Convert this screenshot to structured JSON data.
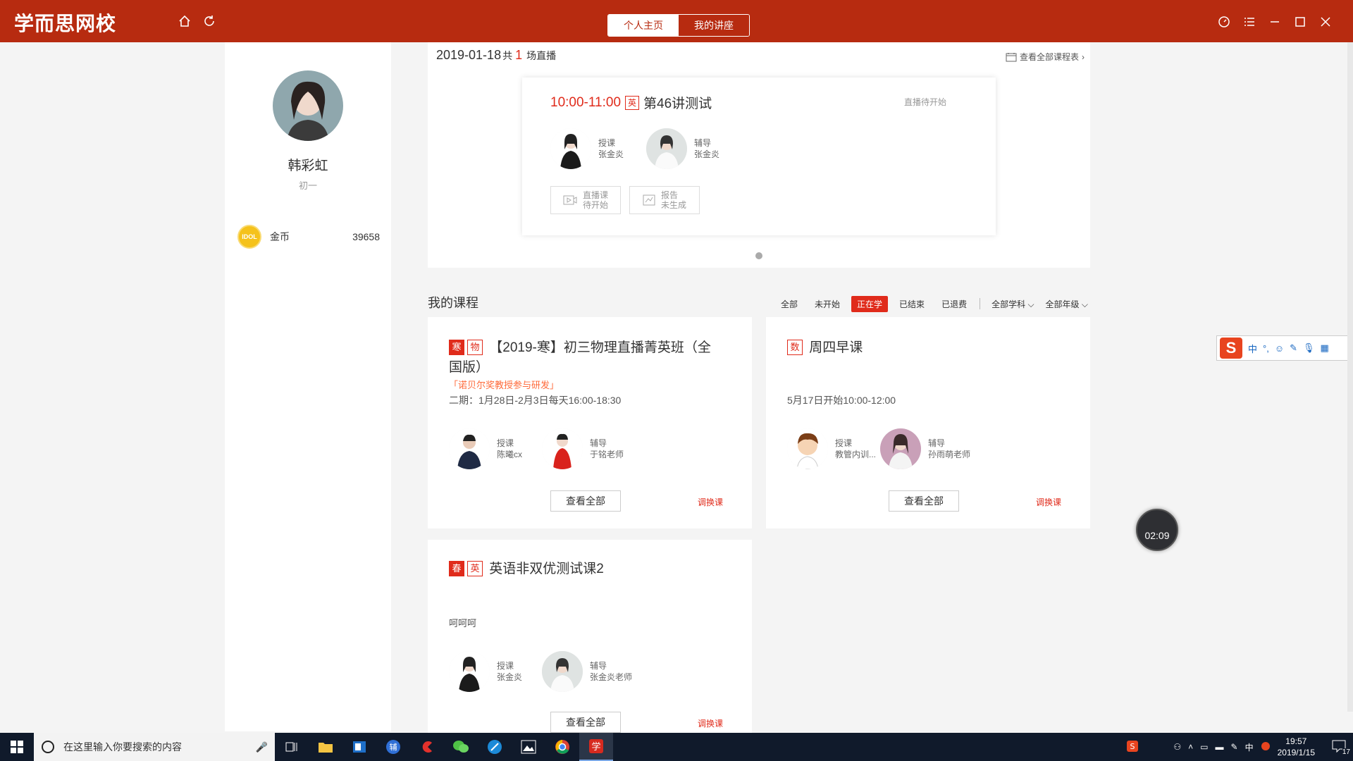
{
  "app": {
    "logo": "学而思网校",
    "tabs": [
      "个人主页",
      "我的讲座"
    ]
  },
  "profile": {
    "name": "韩彩虹",
    "grade": "初一",
    "coin_icon_text": "IDOL",
    "coin_label": "金币",
    "coin_value": "39658"
  },
  "schedule": {
    "date": "2019-01-18",
    "total_prefix": "共",
    "count": "1",
    "suffix": "场直播",
    "view_all": "查看全部课程表",
    "live": {
      "time": "10:00-11:00",
      "subject_tag": "英",
      "title": "第46讲测试",
      "status": "直播待开始",
      "teacher_role": "授课",
      "teacher_name": "张金炎",
      "tutor_role": "辅导",
      "tutor_name": "张金炎",
      "btn_live_line1": "直播课",
      "btn_live_line2": "待开始",
      "btn_report_line1": "报告",
      "btn_report_line2": "未生成"
    }
  },
  "courses": {
    "title": "我的课程",
    "filters": [
      "全部",
      "未开始",
      "正在学",
      "已结束",
      "已退费"
    ],
    "active_filter": "正在学",
    "subject_filter": "全部学科",
    "grade_filter": "全部年级",
    "items": [
      {
        "tags": [
          "寒",
          "物"
        ],
        "title": "【2019-寒】初三物理直播菁英班（全国版）",
        "subtitle": "「诺贝尔奖教授参与研发」",
        "time": "二期：1月28日-2月3日每天16:00-18:30",
        "teacher_role": "授课",
        "teacher_name": "陈曦cx",
        "tutor_role": "辅导",
        "tutor_name": "于铭老师",
        "btn": "查看全部",
        "link": "调换课"
      },
      {
        "tags": [
          "数"
        ],
        "title": "周四早课",
        "subtitle": "",
        "time": "5月17日开始10:00-12:00",
        "teacher_role": "授课",
        "teacher_name": "教管内训...",
        "tutor_role": "辅导",
        "tutor_name": "孙雨萌老师",
        "btn": "查看全部",
        "link": "调换课"
      },
      {
        "tags": [
          "春",
          "英"
        ],
        "title": "英语非双优测试课2",
        "subtitle": "",
        "time": "呵呵呵",
        "teacher_role": "授课",
        "teacher_name": "张金炎",
        "tutor_role": "辅导",
        "tutor_name": "张金炎老师",
        "btn": "查看全部",
        "link": "调换课"
      }
    ]
  },
  "floating": {
    "timer": "02:09",
    "ime_items": [
      "中",
      "°,"
    ]
  },
  "taskbar": {
    "search_placeholder": "在这里输入你要搜索的内容",
    "time": "19:57",
    "date": "2019/1/15",
    "ime": "中",
    "notification_count": "17"
  },
  "colors": {
    "brand": "#b72b10",
    "accent": "#e02b1b"
  }
}
